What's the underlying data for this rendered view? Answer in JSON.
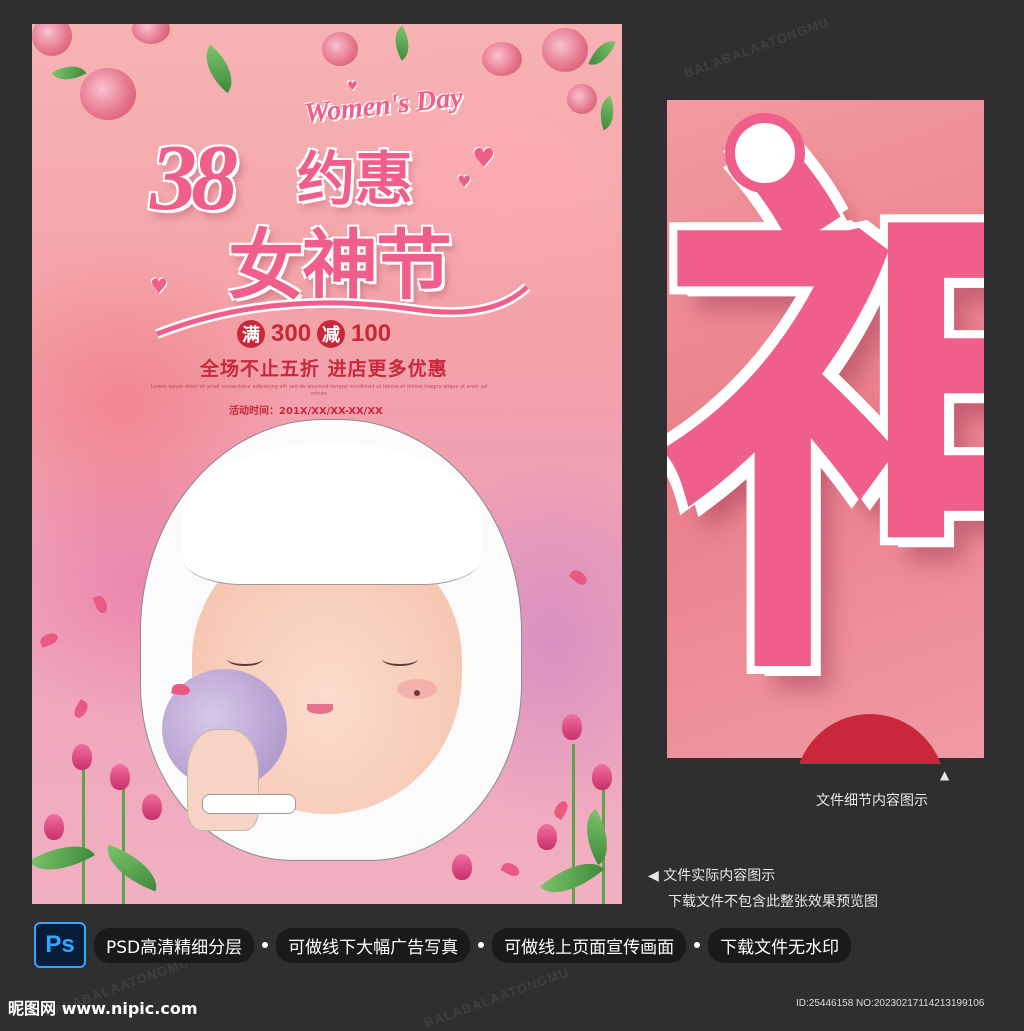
{
  "watermark": "BALABALAATONGMU",
  "poster": {
    "title_en": "Women's Day",
    "title_num": "38",
    "title_cn_line1": "约惠",
    "title_cn_line2": "女神节",
    "promo_man": "满",
    "promo_300": "300",
    "promo_jian": "减",
    "promo_100": "100",
    "subtitle": "全场不止五折  进店更多优惠",
    "small_text": "Lorem ipsum dolor sit amet consectetur adipiscing elit sed do eiusmod tempor incididunt ut labore et dolore magna aliqua ut enim ad minim",
    "date": "活动时间：201X/XX/XX-XX/XX"
  },
  "detail": {
    "char": "神",
    "arrow": "▲",
    "caption": "文件细节内容图示"
  },
  "note": {
    "line1": "◀  文件实际内容图示",
    "line2": "下载文件不包含此整张效果预览图"
  },
  "bottom": {
    "ps_label": "Ps",
    "features": [
      "PSD高清精细分层",
      "可做线下大幅广告写真",
      "可做线上页面宣传画面",
      "下载文件无水印"
    ]
  },
  "footer": {
    "site": "昵图网 www.nipic.com",
    "id": "ID:25446158 NO:20230217114213199106"
  },
  "colors": {
    "accent": "#ef5f8a",
    "red": "#c9283a",
    "bg": "#2f2f31"
  }
}
